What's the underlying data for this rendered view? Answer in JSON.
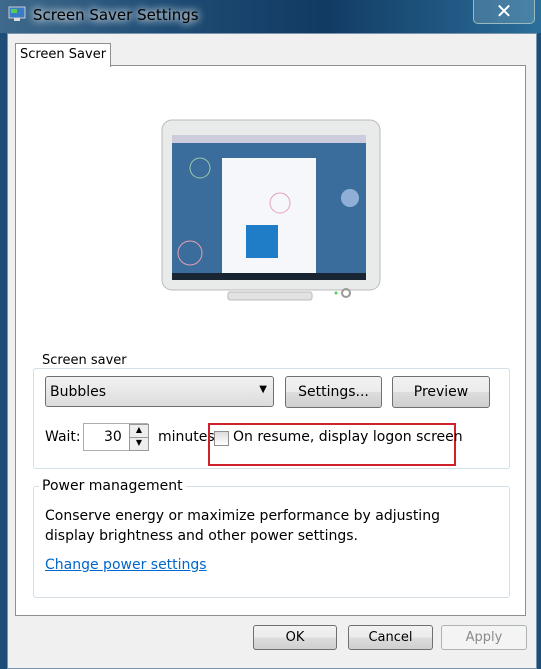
{
  "window": {
    "title": "Screen Saver Settings",
    "close_icon": "close-icon",
    "app_icon": "monitor-icon"
  },
  "tabs": [
    {
      "label": "Screen Saver",
      "selected": true
    }
  ],
  "screen_saver": {
    "group_label": "Screen saver",
    "selected": "Bubbles",
    "settings_label": "Settings...",
    "preview_label": "Preview",
    "wait_label": "Wait:",
    "wait_value": "30",
    "minutes_label": "minutes",
    "resume_label": "On resume, display logon screen",
    "resume_checked": false,
    "highlight_color": "#d0202a"
  },
  "power": {
    "group_label": "Power management",
    "line1": "Conserve energy or maximize performance by adjusting",
    "line2": "display brightness and other power settings.",
    "link": "Change power settings",
    "link_color": "#0066cc"
  },
  "footer": {
    "ok": "OK",
    "cancel": "Cancel",
    "apply": "Apply"
  }
}
